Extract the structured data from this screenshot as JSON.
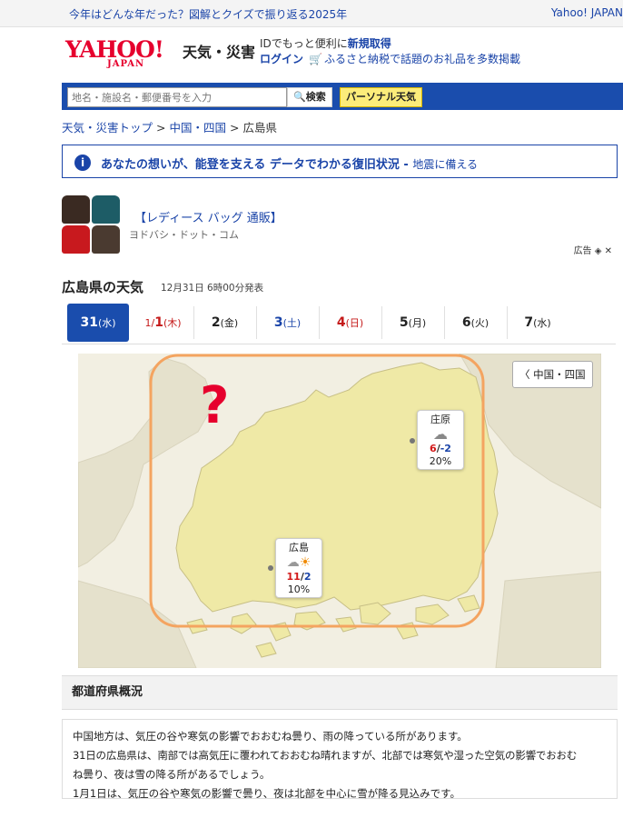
{
  "topbar": {
    "promo": "今年はどんな年だった？図解とクイズで振り返る2025年",
    "brand": "Yahoo! JAPAN"
  },
  "header": {
    "logo": "YAHOO!",
    "logo_sub": "JAPAN",
    "service": "天気・災害",
    "id_text": "IDでもっと便利に",
    "signup": "新規取得",
    "login": "ログイン",
    "furusato": "ふるさと納税で話題のお礼品を多数掲載"
  },
  "search": {
    "placeholder": "地名・施設名・郵便番号を入力",
    "button": "検索",
    "personal": "パーソナル天気"
  },
  "breadcrumb": {
    "top": "天気・災害トップ",
    "region": "中国・四国",
    "current": "広島県",
    "sep": ">"
  },
  "notice": {
    "icon": "i",
    "main": "あなたの想いが、能登を支える データでわかる復旧状況",
    "sub": "地震に備える"
  },
  "ad": {
    "title": "【レディース バッグ 通販】",
    "source": "ヨドバシ・ドット・コム",
    "label": "広告"
  },
  "weather": {
    "title": "広島県の天気",
    "issued": "12月31日 6時00分発表",
    "tabs": [
      {
        "prefix": "",
        "day": "31",
        "wd": "(水)"
      },
      {
        "prefix": "1/",
        "day": "1",
        "wd": "(木)"
      },
      {
        "prefix": "",
        "day": "2",
        "wd": "(金)"
      },
      {
        "prefix": "",
        "day": "3",
        "wd": "(土)"
      },
      {
        "prefix": "",
        "day": "4",
        "wd": "(日)"
      },
      {
        "prefix": "",
        "day": "5",
        "wd": "(月)"
      },
      {
        "prefix": "",
        "day": "6",
        "wd": "(火)"
      },
      {
        "prefix": "",
        "day": "7",
        "wd": "(水)"
      }
    ],
    "region_button": "中国・四国",
    "question_mark": "?",
    "cities": [
      {
        "name": "庄原",
        "icon": "cloudy-icon",
        "high": "6",
        "low": "-2",
        "pop": "20%"
      },
      {
        "name": "広島",
        "icon": "cloudy-sunny-icon",
        "high": "11",
        "low": "2",
        "pop": "10%"
      }
    ]
  },
  "overview": {
    "title": "都道府県概況",
    "lines": [
      "中国地方は、気圧の谷や寒気の影響でおおむね曇り、雨の降っている所があります。",
      "31日の広島県は、南部では高気圧に覆われておおむね晴れますが、北部では寒気や湿った空気の影響でおおむ",
      "ね曇り、夜は雪の降る所があるでしょう。",
      "1月1日は、気圧の谷や寒気の影響で曇り、夜は北部を中心に雪が降る見込みです。"
    ]
  },
  "colors": {
    "brand_red": "#e6002d",
    "nav_blue": "#1a4dad",
    "link_blue": "#1a44a8",
    "map_land": "#efe9a6",
    "highlight_orange": "#f4a460"
  }
}
